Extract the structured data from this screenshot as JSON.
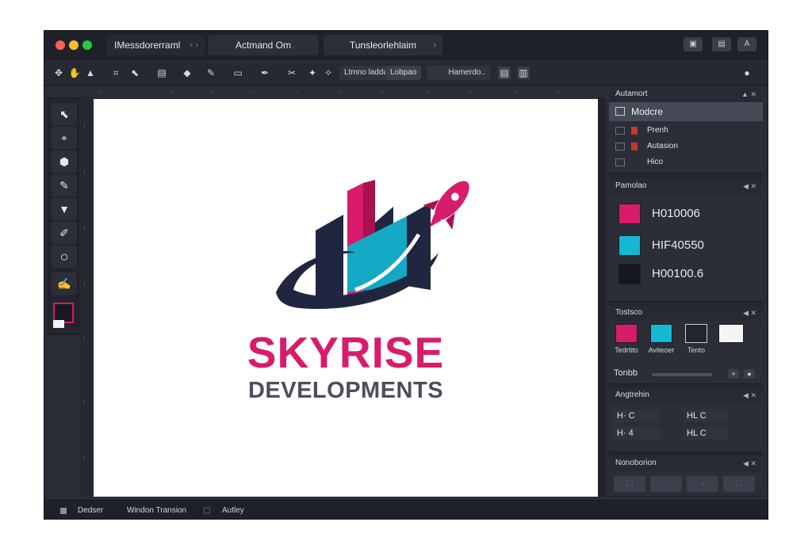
{
  "window": {
    "tabs": [
      {
        "label": "IMessdorerraml",
        "nav": "‹ ›"
      },
      {
        "label": "Actmand Om",
        "nav": ""
      },
      {
        "label": "Tunsleorlehlaim",
        "nav": "›"
      }
    ],
    "controls": [
      "▣",
      "▤",
      "A"
    ]
  },
  "toolbar": {
    "icons": [
      "move-icon",
      "hand-icon",
      "lock-icon",
      "crop-icon",
      "select-icon",
      "frame-icon",
      "diamond-icon",
      "brush-icon",
      "image-icon",
      "pen-icon",
      "stamp-icon",
      "wand-icon"
    ],
    "field_1": "Ltmno ladda",
    "field_2": "Lobpao",
    "field_3": "Hamerdo..",
    "right_icon": "●"
  },
  "tools": {
    "items": [
      "⬉",
      "⌖",
      "⬢",
      "✎",
      "▼",
      "✐",
      "○",
      "✍"
    ]
  },
  "canvas": {
    "logo_main": "SKYRISE",
    "logo_sub": "DEVELOPMENTS",
    "colors": {
      "magenta": "#d81b6a",
      "navy": "#202640",
      "teal": "#13a9c4",
      "gray": "#4b4f5b"
    }
  },
  "panel": {
    "layers": {
      "title": "Autamort",
      "head_icons": "▲ ✕",
      "active": "Modcre",
      "rows": [
        "Prenh",
        "Autasion",
        "Hico"
      ]
    },
    "palette": {
      "title": "Pamolao",
      "head_icons": "◀ ✕",
      "items": [
        {
          "code": "H010006",
          "color": "#d81b6a"
        },
        {
          "code": "HIF40550",
          "color": "#13b9d2"
        },
        {
          "code": "H00100.6",
          "color": "#161821"
        }
      ]
    },
    "swatches": {
      "title": "Tostsco",
      "head_icons": "◀ ✕",
      "items": [
        {
          "label": "Tedrtito",
          "color": "#d81b6a"
        },
        {
          "label": "Aviteoer",
          "color": "#13b9d2"
        },
        {
          "label": "Tento",
          "color": "#222530"
        },
        {
          "label": "",
          "color": "#f5f5f5"
        }
      ],
      "slider_label": "Tonbb",
      "plus": "+",
      "dot": "●"
    },
    "alignment": {
      "title": "Angtrehin",
      "head_icons": "◀ ✕",
      "rows": [
        [
          "H· C",
          "HL C"
        ],
        [
          "H· 4",
          "HL C"
        ]
      ]
    },
    "navigation": {
      "title": "Nonoborion",
      "head_icons": "◀ ✕",
      "thumbs": [
        "⬚",
        "",
        "›",
        "⬚"
      ]
    }
  },
  "statusbar": {
    "item_1": "Dedser",
    "item_2": "Windon Transion",
    "item_3": "Autley"
  }
}
